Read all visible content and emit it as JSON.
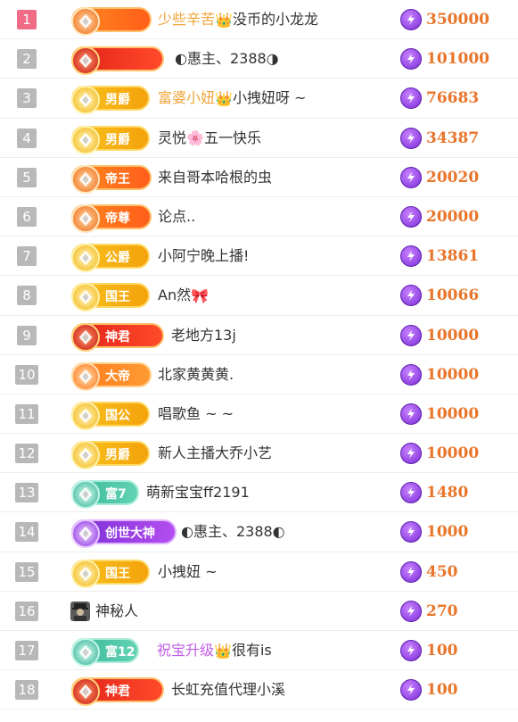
{
  "rows": [
    {
      "rank": "1",
      "badge": "",
      "badge_style": "orange",
      "name_parts": [
        {
          "t": "少些辛苦",
          "c": "hl"
        },
        {
          "t": "👑",
          "c": "emo"
        },
        {
          "t": "没币的小龙龙",
          "c": ""
        }
      ],
      "amount": "350000"
    },
    {
      "rank": "2",
      "badge": "",
      "badge_style": "red",
      "name_parts": [
        {
          "t": "◐惠主、2388◑",
          "c": ""
        }
      ],
      "amount": "101000"
    },
    {
      "rank": "3",
      "badge": "男爵",
      "badge_style": "gold",
      "name_parts": [
        {
          "t": "富婆小妞",
          "c": "hl"
        },
        {
          "t": "👑",
          "c": "emo"
        },
        {
          "t": "小拽妞呀 ~",
          "c": ""
        }
      ],
      "amount": "76683"
    },
    {
      "rank": "4",
      "badge": "男爵",
      "badge_style": "gold",
      "name_parts": [
        {
          "t": "灵悦",
          "c": ""
        },
        {
          "t": "🌸",
          "c": "emo"
        },
        {
          "t": "五一快乐",
          "c": ""
        }
      ],
      "amount": "34387"
    },
    {
      "rank": "5",
      "badge": "帝王",
      "badge_style": "orange",
      "name_parts": [
        {
          "t": "来自哥本哈根的虫",
          "c": ""
        }
      ],
      "amount": "20020"
    },
    {
      "rank": "6",
      "badge": "帝尊",
      "badge_style": "orange",
      "name_parts": [
        {
          "t": "论点..",
          "c": ""
        }
      ],
      "amount": "20000"
    },
    {
      "rank": "7",
      "badge": "公爵",
      "badge_style": "gold",
      "name_parts": [
        {
          "t": "小阿宁晚上播!",
          "c": ""
        }
      ],
      "amount": "13861"
    },
    {
      "rank": "8",
      "badge": "国王",
      "badge_style": "gold",
      "name_parts": [
        {
          "t": "An然",
          "c": ""
        },
        {
          "t": "🎀",
          "c": "emo"
        }
      ],
      "amount": "10066"
    },
    {
      "rank": "9",
      "badge": "神君",
      "badge_style": "red",
      "name_parts": [
        {
          "t": "老地方13j",
          "c": ""
        }
      ],
      "amount": "10000"
    },
    {
      "rank": "10",
      "badge": "大帝",
      "badge_style": "orangeplain",
      "name_parts": [
        {
          "t": "北家黄黄黄.",
          "c": ""
        }
      ],
      "amount": "10000"
    },
    {
      "rank": "11",
      "badge": "国公",
      "badge_style": "gold",
      "name_parts": [
        {
          "t": "唱歌鱼 ~ ~",
          "c": ""
        }
      ],
      "amount": "10000"
    },
    {
      "rank": "12",
      "badge": "男爵",
      "badge_style": "gold",
      "name_parts": [
        {
          "t": "新人主播大乔小艺",
          "c": ""
        }
      ],
      "amount": "10000"
    },
    {
      "rank": "13",
      "badge": "富7",
      "badge_style": "teal",
      "name_parts": [
        {
          "t": "萌新宝宝ff2191",
          "c": ""
        }
      ],
      "amount": "1480"
    },
    {
      "rank": "14",
      "badge": "创世大神",
      "badge_style": "purple",
      "name_parts": [
        {
          "t": "◐惠主、2388◐",
          "c": ""
        }
      ],
      "amount": "1000"
    },
    {
      "rank": "15",
      "badge": "国王",
      "badge_style": "gold",
      "name_parts": [
        {
          "t": "小拽妞 ~",
          "c": ""
        }
      ],
      "amount": "450"
    },
    {
      "rank": "16",
      "badge": "",
      "badge_style": "none",
      "name_parts": [
        {
          "t": "神秘人",
          "c": ""
        }
      ],
      "amount": "270"
    },
    {
      "rank": "17",
      "badge": "富12",
      "badge_style": "teal",
      "name_parts": [
        {
          "t": "祝宝升级",
          "c": "hlpink"
        },
        {
          "t": "👑",
          "c": "emo"
        },
        {
          "t": "很有is",
          "c": ""
        }
      ],
      "amount": "100"
    },
    {
      "rank": "18",
      "badge": "神君",
      "badge_style": "red",
      "name_parts": [
        {
          "t": "长虹充值代理小溪",
          "c": ""
        }
      ],
      "amount": "100"
    }
  ],
  "colors": {
    "rank_top": "#f06b86",
    "rank_default": "#b8b8b8",
    "amount": "#e8752a",
    "highlight_gold": "#f0a53a",
    "highlight_pink": "#c05ce6",
    "coin": "#8a2fe0"
  },
  "icons": {
    "coin": "lightning-coin-icon",
    "badge_emblem": "rank-emblem-icon",
    "mystery_user": "mystery-avatar-icon"
  }
}
